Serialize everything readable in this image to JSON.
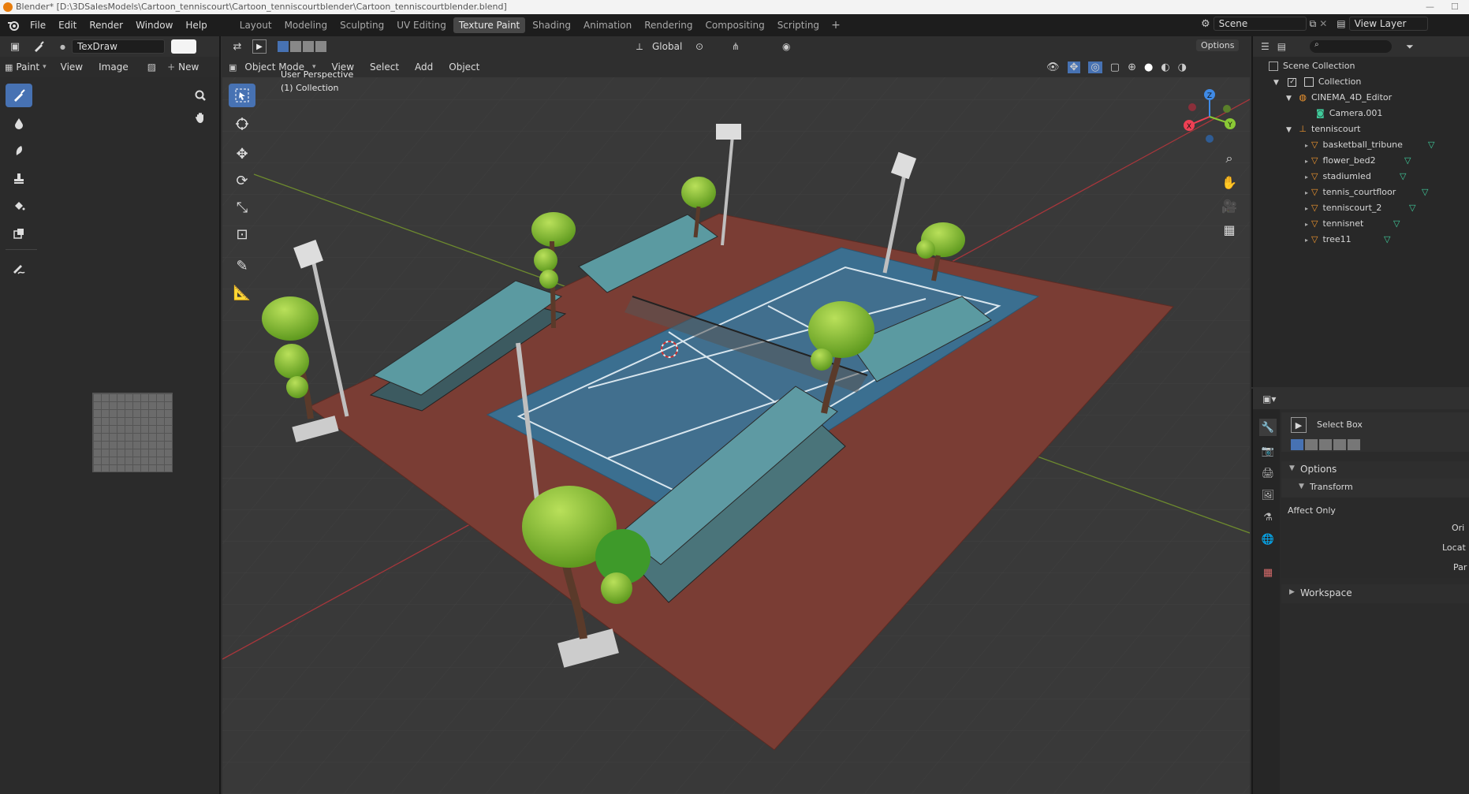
{
  "title_bar": {
    "text": "Blender* [D:\\3DSalesModels\\Cartoon_tenniscourt\\Cartoon_tenniscourtblender\\Cartoon_tenniscourtblender.blend]"
  },
  "menus": [
    "File",
    "Edit",
    "Render",
    "Window",
    "Help"
  ],
  "workspaces": [
    {
      "label": "Layout"
    },
    {
      "label": "Modeling"
    },
    {
      "label": "Sculpting"
    },
    {
      "label": "UV Editing"
    },
    {
      "label": "Texture Paint"
    },
    {
      "label": "Shading"
    },
    {
      "label": "Animation"
    },
    {
      "label": "Rendering"
    },
    {
      "label": "Compositing"
    },
    {
      "label": "Scripting"
    }
  ],
  "active_workspace": "Texture Paint",
  "scene": {
    "name": "Scene",
    "view_layer": "View Layer"
  },
  "image_editor": {
    "brush_name": "TexDraw",
    "mode": "Paint",
    "view": "View",
    "image": "Image",
    "new": "New"
  },
  "viewport": {
    "transform_orientation": "Global",
    "options_label": "Options",
    "mode": "Object Mode",
    "menus": [
      "View",
      "Select",
      "Add",
      "Object"
    ],
    "perspective_label": "User Perspective",
    "collection_label": "(1) Collection",
    "gizmo_axes": [
      "Z",
      "X",
      "Y"
    ],
    "colors": {
      "x": "#ee4054",
      "y": "#8ac935",
      "z": "#3f8ae6",
      "court": "#3b6f90",
      "ground": "#7a3d34"
    }
  },
  "outliner": {
    "root": "Scene Collection",
    "items": [
      {
        "label": "Collection",
        "level": 1,
        "icon": "collection-icon"
      },
      {
        "label": "CINEMA_4D_Editor",
        "level": 2,
        "icon": "camera-object-icon"
      },
      {
        "label": "Camera.001",
        "level": 3,
        "icon": "camera-data-icon"
      },
      {
        "label": "tenniscourt",
        "level": 2,
        "icon": "empty-icon"
      },
      {
        "label": "basketball_tribune",
        "level": 3,
        "icon": "mesh-icon"
      },
      {
        "label": "flower_bed2",
        "level": 3,
        "icon": "mesh-icon"
      },
      {
        "label": "stadiumled",
        "level": 3,
        "icon": "mesh-icon"
      },
      {
        "label": "tennis_courtfloor",
        "level": 3,
        "icon": "mesh-icon"
      },
      {
        "label": "tenniscourt_2",
        "level": 3,
        "icon": "mesh-icon"
      },
      {
        "label": "tennisnet",
        "level": 3,
        "icon": "mesh-icon"
      },
      {
        "label": "tree11",
        "level": 3,
        "icon": "mesh-icon"
      }
    ]
  },
  "properties": {
    "tool_name": "Select Box",
    "options_label": "Options",
    "transform_label": "Transform",
    "affect_only": "Affect Only",
    "truncated": [
      "Ori",
      "Locat",
      "Par"
    ],
    "workspace_label": "Workspace"
  }
}
